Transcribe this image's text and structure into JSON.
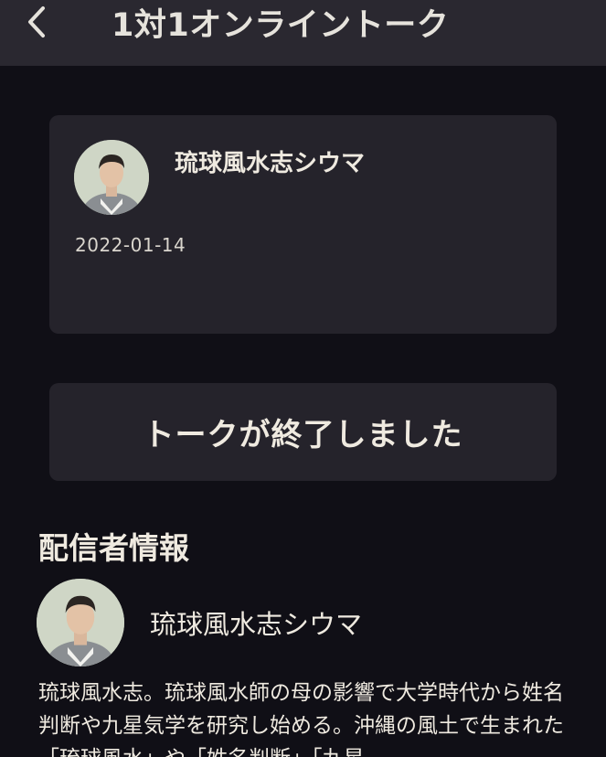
{
  "header": {
    "title": "1対1オンライントーク",
    "back_icon": "chevron-left-icon"
  },
  "talk_card": {
    "host_name": "琉球風水志シウマ",
    "date": "2022-01-14"
  },
  "end_button": {
    "label": "トークが終了しました"
  },
  "host_info": {
    "section_title": "配信者情報",
    "name": "琉球風水志シウマ",
    "bio": "琉球風水志。琉球風水師の母の影響で大学時代から姓名判断や九星気学を研究し始める。沖縄の風土で生まれた「琉球風水」や「姓名判断」「九星"
  },
  "colors": {
    "background": "#100f16",
    "header_bg": "#2a2830",
    "card_bg": "#25232b",
    "text": "#efeae0"
  }
}
